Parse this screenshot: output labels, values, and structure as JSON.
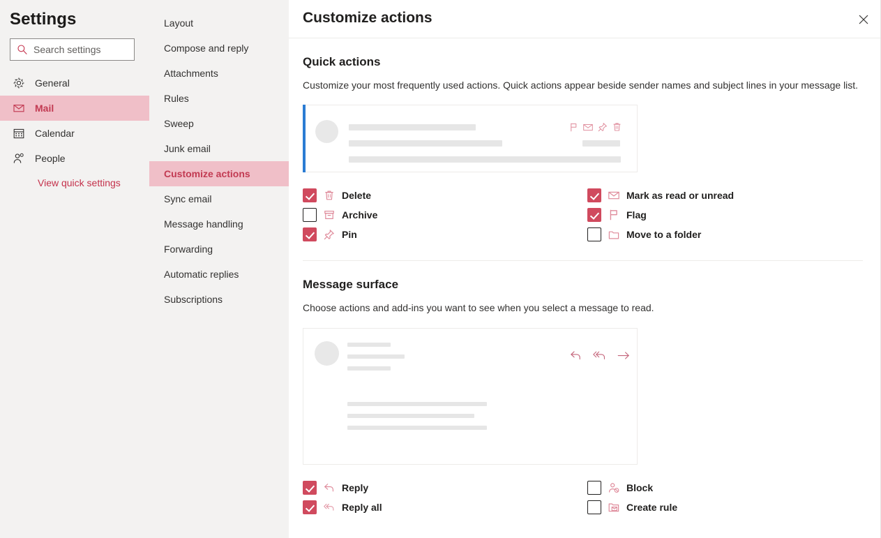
{
  "settings": {
    "title": "Settings",
    "search": {
      "placeholder": "Search settings",
      "value": "",
      "icon": "search-icon"
    },
    "nav_items": [
      {
        "label": "General",
        "icon": "gear-icon",
        "selected": false
      },
      {
        "label": "Mail",
        "icon": "envelope-icon",
        "selected": true
      },
      {
        "label": "Calendar",
        "icon": "calendar-icon",
        "selected": false
      },
      {
        "label": "People",
        "icon": "people-icon",
        "selected": false
      }
    ],
    "quick_settings_link": "View quick settings"
  },
  "subnav": {
    "items": [
      {
        "label": "Layout",
        "selected": false
      },
      {
        "label": "Compose and reply",
        "selected": false
      },
      {
        "label": "Attachments",
        "selected": false
      },
      {
        "label": "Rules",
        "selected": false
      },
      {
        "label": "Sweep",
        "selected": false
      },
      {
        "label": "Junk email",
        "selected": false
      },
      {
        "label": "Customize actions",
        "selected": true
      },
      {
        "label": "Sync email",
        "selected": false
      },
      {
        "label": "Message handling",
        "selected": false
      },
      {
        "label": "Forwarding",
        "selected": false
      },
      {
        "label": "Automatic replies",
        "selected": false
      },
      {
        "label": "Subscriptions",
        "selected": false
      }
    ]
  },
  "panel": {
    "title": "Customize actions",
    "close_icon": "close-icon"
  },
  "quick_actions": {
    "heading": "Quick actions",
    "description": "Customize your most frequently used actions. Quick actions appear beside sender names and subject lines in your message list.",
    "preview_icons": [
      "flag-icon",
      "envelope-icon",
      "pin-icon",
      "trash-icon"
    ],
    "options_left": [
      {
        "label": "Delete",
        "icon": "trash-icon",
        "checked": true
      },
      {
        "label": "Archive",
        "icon": "archive-icon",
        "checked": false
      },
      {
        "label": "Pin",
        "icon": "pin-icon",
        "checked": true
      }
    ],
    "options_right": [
      {
        "label": "Mark as read or unread",
        "icon": "envelope-icon",
        "checked": true
      },
      {
        "label": "Flag",
        "icon": "flag-icon",
        "checked": true
      },
      {
        "label": "Move to a folder",
        "icon": "folder-icon",
        "checked": false
      }
    ]
  },
  "message_surface": {
    "heading": "Message surface",
    "description": "Choose actions and add-ins you want to see when you select a message to read.",
    "preview_icons": [
      "reply-icon",
      "reply-all-icon",
      "forward-icon"
    ],
    "options_left": [
      {
        "label": "Reply",
        "icon": "reply-icon",
        "checked": true
      },
      {
        "label": "Reply all",
        "icon": "reply-all-icon",
        "checked": true
      }
    ],
    "options_right": [
      {
        "label": "Block",
        "icon": "block-user-icon",
        "checked": false
      },
      {
        "label": "Create rule",
        "icon": "create-rule-icon",
        "checked": false
      }
    ]
  },
  "colors": {
    "accent": "#c4314b",
    "checkbox_fill": "#d04a5e",
    "selected_row": "#f0bfc8",
    "preview_accent_bar": "#2b7cd3",
    "icon_pink": "#df8b9b"
  }
}
